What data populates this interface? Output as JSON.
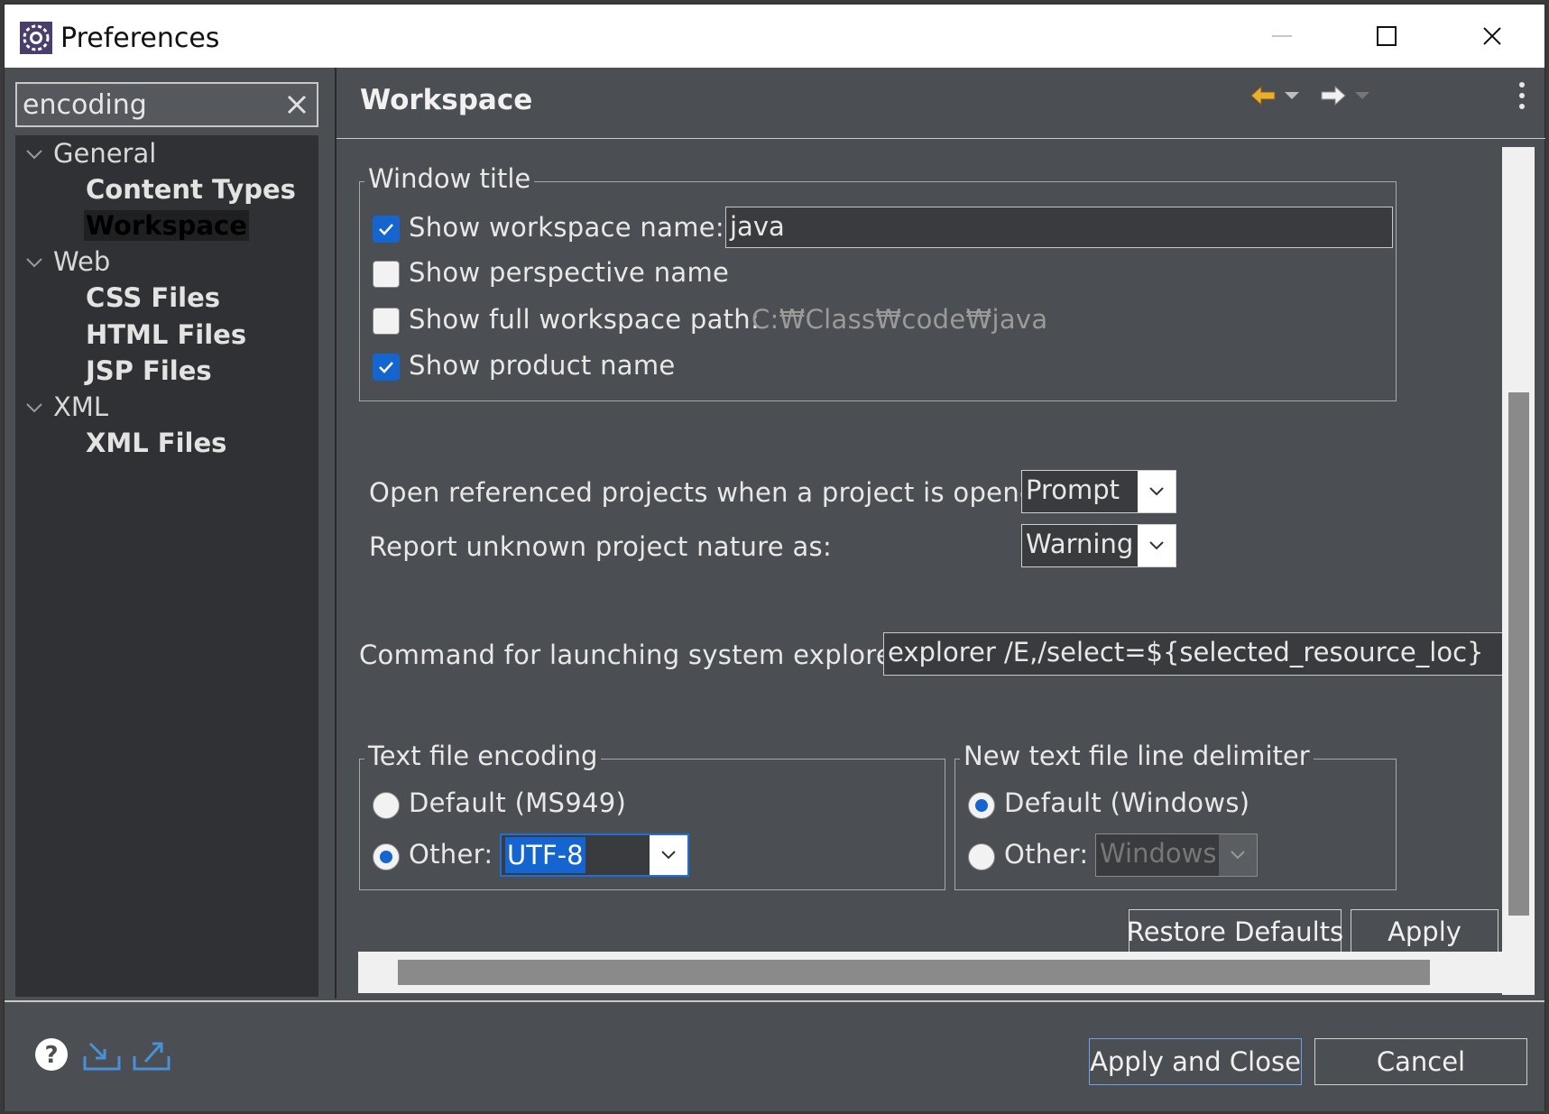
{
  "window": {
    "title": "Preferences"
  },
  "filter": {
    "value": "encoding"
  },
  "tree": {
    "general": "General",
    "content_types": "Content Types",
    "workspace": "Workspace",
    "web": "Web",
    "css_files": "CSS Files",
    "html_files": "HTML Files",
    "jsp_files": "JSP Files",
    "xml": "XML",
    "xml_files": "XML Files"
  },
  "page": {
    "title": "Workspace"
  },
  "window_title_group": {
    "legend": "Window title",
    "show_workspace_name": "Show workspace name:",
    "workspace_name_value": "java",
    "show_perspective_name": "Show perspective name",
    "show_full_workspace_path": "Show full workspace path:",
    "workspace_path_value": "C:₩Class₩code₩java",
    "show_product_name": "Show product name"
  },
  "options": {
    "open_referenced_label": "Open referenced projects when a project is opened:",
    "open_referenced_value": "Prompt",
    "report_unknown_label": "Report unknown project nature as:",
    "report_unknown_value": "Warning",
    "explorer_label": "Command for launching system explorer:",
    "explorer_value": "explorer /E,/select=${selected_resource_loc}"
  },
  "encoding_group": {
    "legend": "Text file encoding",
    "default_label": "Default (MS949)",
    "other_label": "Other:",
    "other_value": "UTF-8"
  },
  "delimiter_group": {
    "legend": "New text file line delimiter",
    "default_label": "Default (Windows)",
    "other_label": "Other:",
    "other_value": "Windows"
  },
  "buttons": {
    "restore_defaults": "Restore Defaults",
    "apply": "Apply",
    "apply_and_close": "Apply and Close",
    "cancel": "Cancel"
  },
  "colors": {
    "accent": "#1565d0",
    "nav_arrow": "#e8b030",
    "background": "#4b4e52"
  },
  "icons": [
    "app-icon",
    "clear-icon",
    "chevron-down-icon",
    "back-arrow-icon",
    "forward-arrow-icon",
    "menu-icon",
    "help-icon",
    "import-icon",
    "export-icon"
  ]
}
